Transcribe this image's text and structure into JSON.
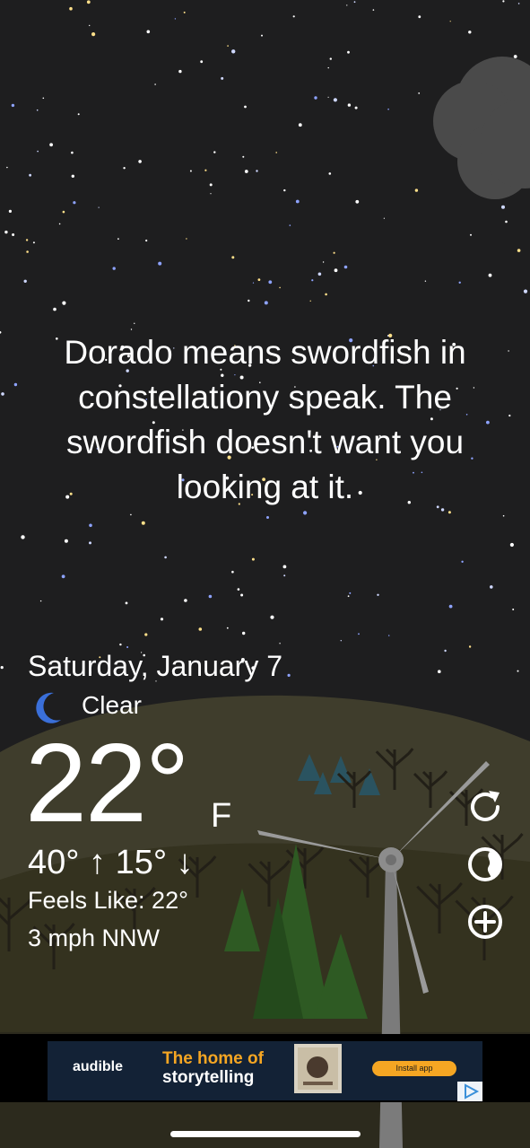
{
  "fact": "Dorado means swordfish in constellationy speak. The swordfish doesn't want you looking at it.",
  "date": "Saturday, January 7",
  "condition": {
    "icon": "moon-icon",
    "label": "Clear"
  },
  "temperature": {
    "value": "22°",
    "unit": "F"
  },
  "high_low": "40° ↑ 15° ↓",
  "feels_like": "Feels Like: 22°",
  "wind": "3 mph NNW",
  "actions": [
    {
      "name": "refresh-button",
      "icon": "refresh-icon"
    },
    {
      "name": "location-button",
      "icon": "globe-icon"
    },
    {
      "name": "add-location-button",
      "icon": "plus-circle-icon"
    }
  ],
  "ad": {
    "brand": "audible",
    "headline_line1": "The home of",
    "headline_line2": "storytelling",
    "button": "Install app",
    "accent_color": "#f5a623"
  },
  "colors": {
    "sky": "#1e1e1f",
    "hills": "#3d3b2b",
    "ground": "#2f2d22"
  }
}
